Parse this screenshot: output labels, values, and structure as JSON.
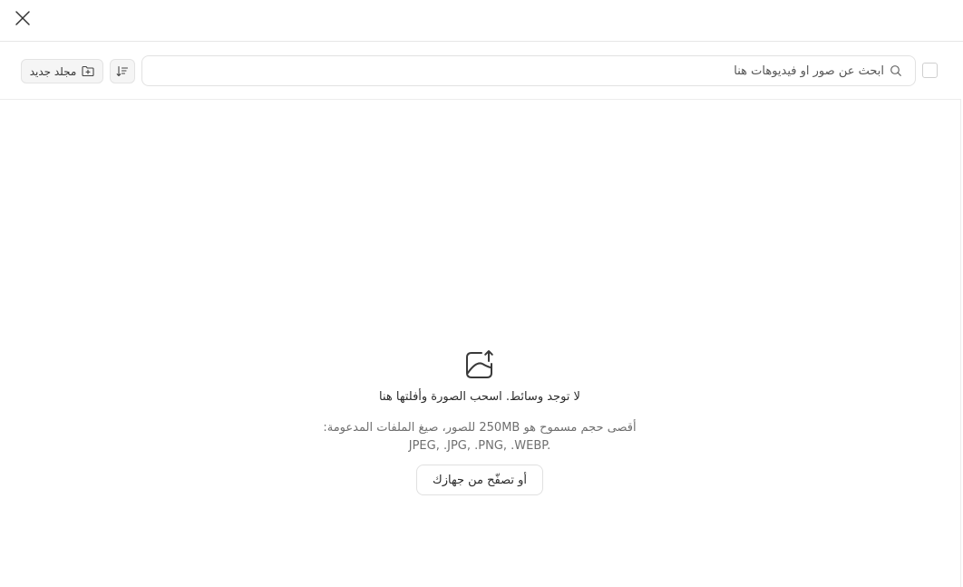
{
  "header": {
    "close_icon": "close-icon"
  },
  "toolbar": {
    "new_folder_label": "مجلد جديد",
    "new_folder_icon": "folder-plus-icon",
    "sort_icon": "sort-icon",
    "search": {
      "placeholder": "ابحث عن صور او فيديوهات هنا",
      "value": "",
      "icon": "search-icon"
    },
    "select_all_checked": false
  },
  "empty_state": {
    "icon": "image-upload-icon",
    "title": "لا توجد وسائط. اسحب الصورة وأفلتها هنا",
    "description": "أقصى حجم مسموح هو 250MB للصور، صيغ الملفات المدعومة:",
    "formats": "JPEG, .JPG, .PNG, .WEBP.",
    "browse_label": "أو تصفّح من جهازك"
  },
  "colors": {
    "border": "#e3e3e3",
    "button_bg": "#f5f5f5",
    "text": "#2b2b2b",
    "muted_text": "#6f6f6f"
  }
}
